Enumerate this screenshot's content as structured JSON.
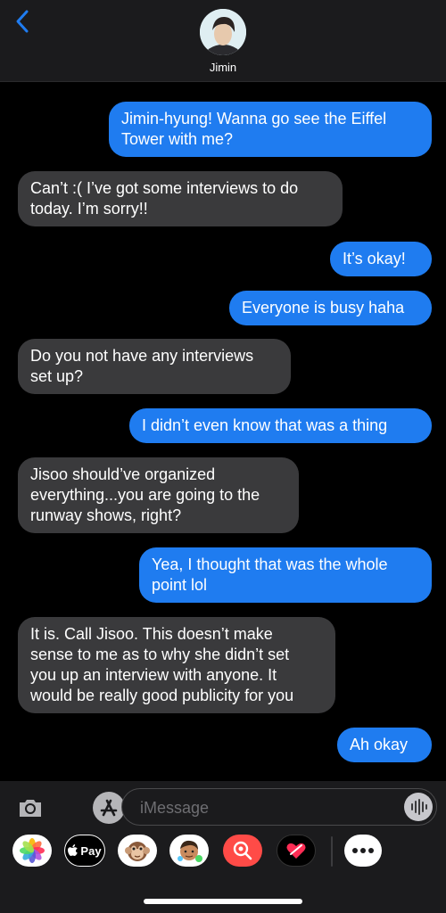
{
  "header": {
    "contact_name": "Jimin",
    "back_icon": "chevron-left-icon",
    "accent_color": "#1f7cf0"
  },
  "messages": [
    {
      "from": "me",
      "text": "Jimin-hyung! Wanna go see the Eiffel\nTower with me?"
    },
    {
      "from": "them",
      "text": "Can’t :( I’ve got some interviews to do\ntoday. I’m sorry!!"
    },
    {
      "from": "me",
      "text": "It’s okay!"
    },
    {
      "from": "me",
      "text": "Everyone is busy haha"
    },
    {
      "from": "them",
      "text": "Do you not have any interviews\nset up?"
    },
    {
      "from": "me",
      "text": "I didn’t even know that was a thing"
    },
    {
      "from": "them",
      "text": "Jisoo should’ve organized\neverything...you are going to the\nrunway shows, right?"
    },
    {
      "from": "me",
      "text": "Yea, I thought that was the whole\npoint lol"
    },
    {
      "from": "them",
      "text": "It is. Call Jisoo. This doesn’t make\nsense to me as to why she didn’t set\nyou up an interview with anyone. It\nwould be really good publicity for you"
    },
    {
      "from": "me",
      "text": "Ah okay"
    }
  ],
  "composer": {
    "placeholder": "iMessage",
    "apps": [
      {
        "name": "photos-icon"
      },
      {
        "name": "apple-pay-icon",
        "label": "Pay"
      },
      {
        "name": "animoji-icon"
      },
      {
        "name": "memoji-icon"
      },
      {
        "name": "image-search-icon"
      },
      {
        "name": "digital-touch-icon"
      },
      {
        "name": "more-icon"
      }
    ]
  }
}
